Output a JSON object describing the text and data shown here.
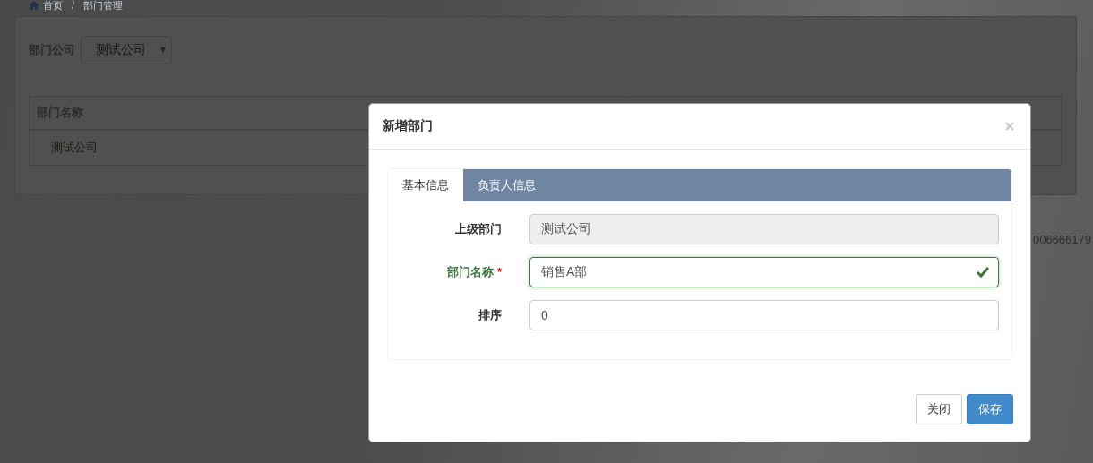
{
  "breadcrumb": {
    "separator": "/",
    "items": [
      {
        "label": "首页"
      },
      {
        "label": "部门管理"
      }
    ]
  },
  "filter": {
    "label": "部门公司",
    "value": "测试公司"
  },
  "table": {
    "columns": [
      "部门名称"
    ],
    "rows": [
      [
        "测试公司"
      ]
    ]
  },
  "background_text": "006666179",
  "dialog": {
    "title": "新增部门",
    "tabs": [
      {
        "label": "基本信息",
        "selected": true
      },
      {
        "label": "负责人信息",
        "selected": false
      }
    ],
    "fields": [
      {
        "label": "上级部门",
        "value": "测试公司",
        "disabled": true,
        "valid": false
      },
      {
        "label": "部门名称",
        "required_mark": "*",
        "value": "销售A部",
        "disabled": false,
        "valid": true
      },
      {
        "label": "排序",
        "value": "0",
        "disabled": false,
        "valid": false
      }
    ],
    "buttons": [
      {
        "label": "关闭",
        "kind": "default"
      },
      {
        "label": "保存",
        "kind": "primary"
      }
    ]
  }
}
